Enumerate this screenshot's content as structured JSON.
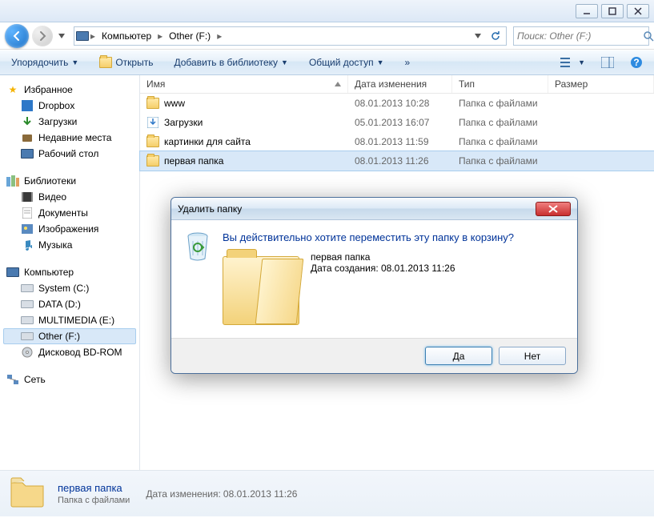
{
  "titlebar": {
    "min": "_",
    "max": "□",
    "close": "×"
  },
  "nav": {
    "crumbs": [
      "Компьютер",
      "Other (F:)"
    ],
    "search_placeholder": "Поиск: Other (F:)"
  },
  "toolbar": {
    "organize": "Упорядочить",
    "open": "Открыть",
    "addlib": "Добавить в библиотеку",
    "share": "Общий доступ",
    "more": "»"
  },
  "sidebar": {
    "favorites": "Избранное",
    "fav_items": [
      "Dropbox",
      "Загрузки",
      "Недавние места",
      "Рабочий стол"
    ],
    "libraries": "Библиотеки",
    "lib_items": [
      "Видео",
      "Документы",
      "Изображения",
      "Музыка"
    ],
    "computer": "Компьютер",
    "drives": [
      "System (C:)",
      "DATA (D:)",
      "MULTIMEDIA (E:)",
      "Other (F:)",
      "Дисковод BD-ROM"
    ],
    "network": "Сеть"
  },
  "columns": {
    "name": "Имя",
    "date": "Дата изменения",
    "type": "Тип",
    "size": "Размер"
  },
  "files": [
    {
      "name": "www",
      "date": "08.01.2013 10:28",
      "type": "Папка с файлами",
      "icon": "folder"
    },
    {
      "name": "Загрузки",
      "date": "05.01.2013 16:07",
      "type": "Папка с файлами",
      "icon": "downloads"
    },
    {
      "name": "картинки для сайта",
      "date": "08.01.2013 11:59",
      "type": "Папка с файлами",
      "icon": "folder"
    },
    {
      "name": "первая папка",
      "date": "08.01.2013 11:26",
      "type": "Папка с файлами",
      "icon": "folder",
      "selected": true
    }
  ],
  "details": {
    "name": "первая папка",
    "sub": "Папка с файлами",
    "meta_label": "Дата изменения:",
    "meta_value": "08.01.2013 11:26"
  },
  "dialog": {
    "title": "Удалить папку",
    "question": "Вы действительно хотите переместить эту папку в корзину?",
    "item_name": "первая папка",
    "created_label": "Дата создания:",
    "created_value": "08.01.2013 11:26",
    "yes": "Да",
    "no": "Нет"
  }
}
